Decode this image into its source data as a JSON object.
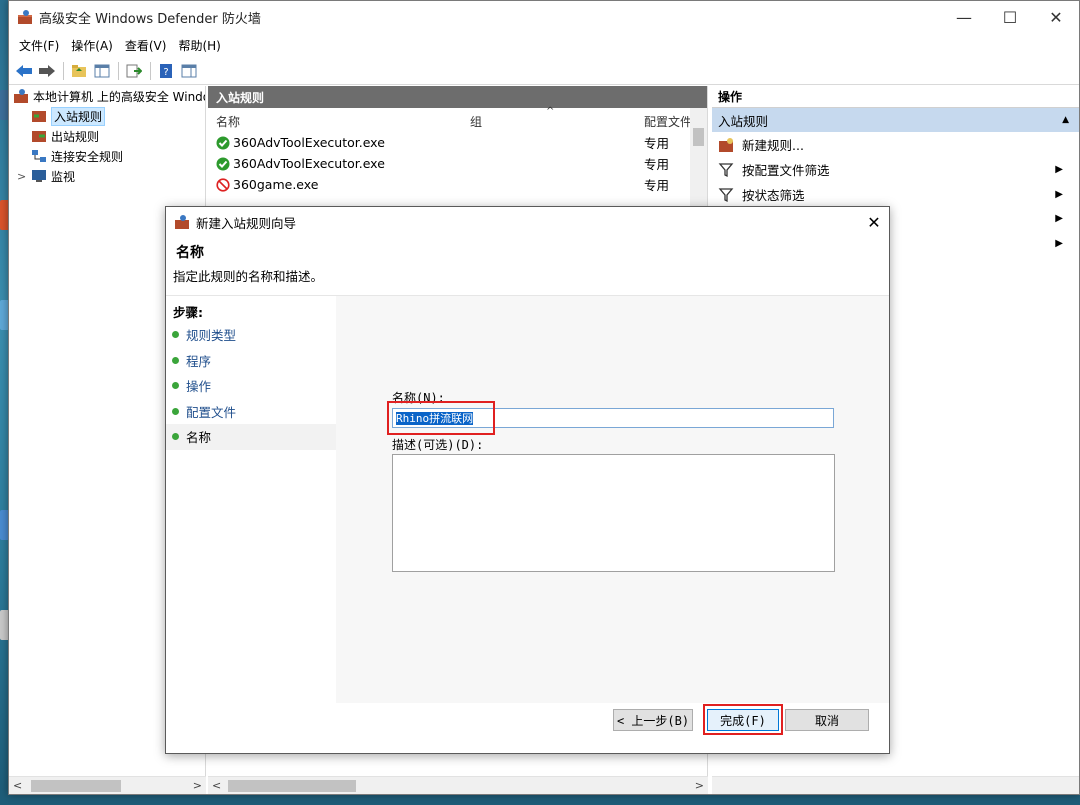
{
  "window": {
    "title": "高级安全 Windows Defender 防火墙",
    "minimize": "—",
    "maximize": "☐",
    "close": "✕"
  },
  "menu": [
    "文件(F)",
    "操作(A)",
    "查看(V)",
    "帮助(H)"
  ],
  "tree": {
    "root": "本地计算机 上的高级安全 Windows Defender 防火墙",
    "items": [
      "入站规则",
      "出站规则",
      "连接安全规则",
      "监视"
    ],
    "expander": ">"
  },
  "center": {
    "header": "入站规则",
    "columns": {
      "name": "名称",
      "group": "组",
      "profile": "配置文件"
    },
    "rows": [
      {
        "name": "360AdvToolExecutor.exe",
        "profile": "专用",
        "status": "allow"
      },
      {
        "name": "360AdvToolExecutor.exe",
        "profile": "专用",
        "status": "allow"
      },
      {
        "name": "360game.exe",
        "profile": "专用",
        "status": "block"
      }
    ]
  },
  "actions": {
    "title": "操作",
    "section": "入站规则",
    "items": [
      "新建规则...",
      "按配置文件筛选",
      "按状态筛选"
    ]
  },
  "dialog": {
    "title": "新建入站规则向导",
    "heading": "名称",
    "description": "指定此规则的名称和描述。",
    "steps_title": "步骤:",
    "steps": [
      "规则类型",
      "程序",
      "操作",
      "配置文件",
      "名称"
    ],
    "name_label": "名称(N):",
    "name_value": "Rhino拼流联网",
    "desc_label": "描述(可选)(D):",
    "back_button": "< 上一步(B)",
    "finish_button": "完成(F)",
    "cancel_button": "取消"
  },
  "colors": {
    "highlight": "#e02020",
    "selection": "#0a64c8",
    "actions_section": "#c6d9ee"
  }
}
